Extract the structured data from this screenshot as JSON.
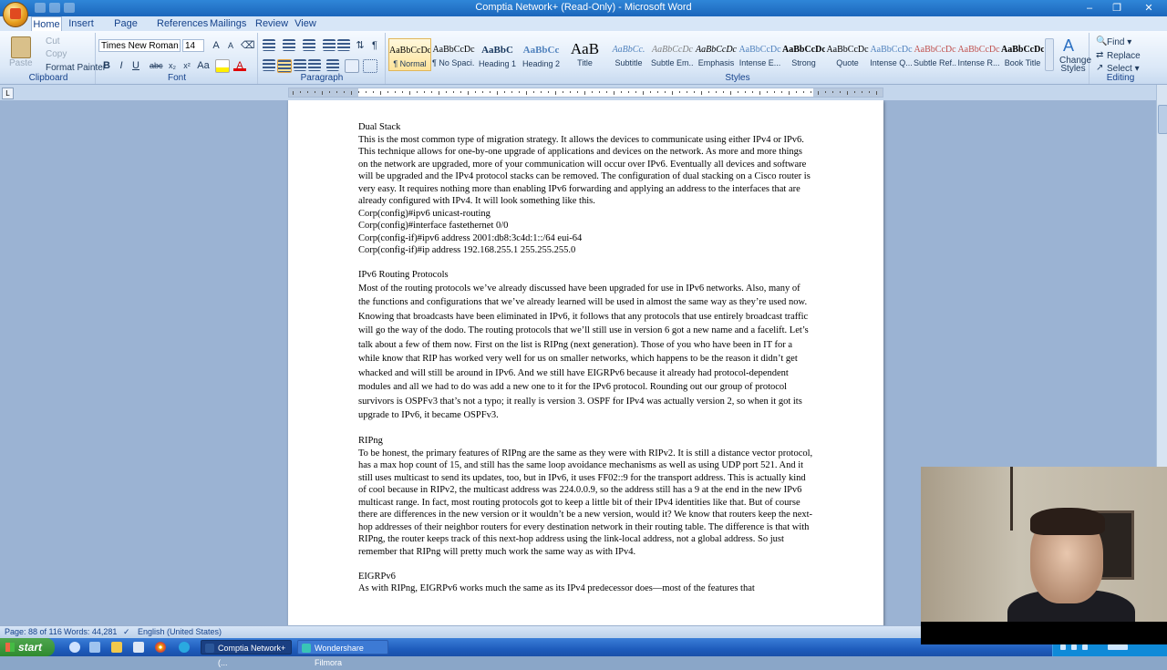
{
  "window": {
    "title": "Comptia Network+ (Read-Only) - Microsoft Word",
    "controls": [
      "–",
      "❐",
      "✕"
    ]
  },
  "tabs": [
    "Home",
    "Insert",
    "Page Layout",
    "References",
    "Mailings",
    "Review",
    "View"
  ],
  "ribbon": {
    "clipboard": {
      "paste": "Paste",
      "cut": "Cut",
      "copy": "Copy",
      "format_painter": "Format Painter",
      "label": "Clipboard"
    },
    "font": {
      "name": "Times New Roman",
      "size": "14",
      "label": "Font"
    },
    "paragraph": {
      "label": "Paragraph"
    },
    "styles": {
      "label": "Styles",
      "change_styles": "Change Styles",
      "items": [
        {
          "sample": "AaBbCcDc",
          "name": "¶ Normal"
        },
        {
          "sample": "AaBbCcDc",
          "name": "¶ No Spaci..."
        },
        {
          "sample": "AaBbC",
          "name": "Heading 1"
        },
        {
          "sample": "AaBbCc",
          "name": "Heading 2"
        },
        {
          "sample": "AaB",
          "name": "Title"
        },
        {
          "sample": "AaBbCc.",
          "name": "Subtitle"
        },
        {
          "sample": "AaBbCcDc",
          "name": "Subtle Em..."
        },
        {
          "sample": "AaBbCcDc",
          "name": "Emphasis"
        },
        {
          "sample": "AaBbCcDc",
          "name": "Intense E..."
        },
        {
          "sample": "AaBbCcDc",
          "name": "Strong"
        },
        {
          "sample": "AaBbCcDc",
          "name": "Quote"
        },
        {
          "sample": "AaBbCcDc",
          "name": "Intense Q..."
        },
        {
          "sample": "AaBbCcDc",
          "name": "Subtle Ref..."
        },
        {
          "sample": "AaBbCcDc",
          "name": "Intense R..."
        },
        {
          "sample": "AaBbCcDc",
          "name": "Book Title"
        }
      ]
    },
    "editing": {
      "find": "Find ▾",
      "replace": "Replace",
      "select": "Select ▾",
      "label": "Editing"
    }
  },
  "document": {
    "dual_stack_heading": "Dual Stack",
    "dual_stack_body": "This is the most common type of migration strategy. It allows the devices to communicate using either IPv4 or IPv6. This technique allows for one-by-one upgrade of applications and devices on the network. As more and more things on the network are upgraded, more of your communication will occur over IPv6. Eventually all devices and software will be upgraded and the IPv4 protocol stacks can be removed. The configuration of dual stacking on a Cisco router is very easy. It requires nothing more than enabling IPv6 forwarding and applying an address to the interfaces that are already configured with IPv4. It will look something like this.",
    "code": [
      "Corp(config)#ipv6 unicast-routing",
      "Corp(config)#interface fastethernet 0/0",
      "Corp(config-if)#ipv6 address 2001:db8:3c4d:1::/64 eui-64",
      "Corp(config-if)#ip address 192.168.255.1 255.255.255.0"
    ],
    "routing_heading": "IPv6 Routing Protocols",
    "routing_body": "Most of the routing protocols we’ve already discussed have been upgraded for use in IPv6 networks. Also, many of the functions and configurations that we’ve already learned will be used in almost the same way as they’re used now. Knowing that broadcasts have been eliminated in IPv6, it follows that any protocols that use entirely broadcast traffic will go the way of the dodo. The routing protocols that we’ll still use in version 6 got a new name and a facelift. Let’s talk about a few of them now. First on the list is RIPng (next generation). Those of you who have been in IT for a while know that RIP has worked very well for us on smaller networks, which happens to be the reason it didn’t get whacked and will still be around in IPv6. And we still have EIGRPv6 because it already had protocol-dependent modules and all we had to do was add a new one to it for the IPv6 protocol. Rounding out our group of protocol survivors is OSPFv3 that’s not a typo; it really is version 3. OSPF for IPv4 was actually version 2, so when it got its upgrade to IPv6, it became OSPFv3.",
    "ripng_heading": "RIPng",
    "ripng_body": "To be honest, the primary features of RIPng are the same as they were with RIPv2. It is still a distance vector protocol, has a max hop count of 15, and still has the same loop avoidance mechanisms as well as using UDP port 521. And it still uses multicast to send its updates, too, but in IPv6, it uses FF02::9 for the transport address. This is actually kind of cool because in RIPv2, the multicast address was 224.0.0.9, so the address still has a 9 at the end in the new IPv6 multicast range. In fact, most routing protocols got to keep a little bit of their IPv4 identities like that. But of course there are differences in the new version or it wouldn’t be a new version, would it? We know that routers keep the next-hop addresses of their neighbor routers for every destination network in their routing table. The difference is that with RIPng, the router keeps track of this next-hop address using the link-local address, not a global address. So just remember that RIPng will pretty much work the same way as with IPv4.",
    "eigrp_heading": "EIGRPv6",
    "eigrp_body": "As with RIPng, EIGRPv6 works much the same as its IPv4 predecessor does—most of the features that"
  },
  "status": {
    "page": "Page: 88 of 116",
    "words": "Words: 44,281",
    "language": "English (United States)"
  },
  "taskbar": {
    "start": "start",
    "items": [
      "Comptia Network+ (...",
      "Wondershare Filmora"
    ]
  }
}
